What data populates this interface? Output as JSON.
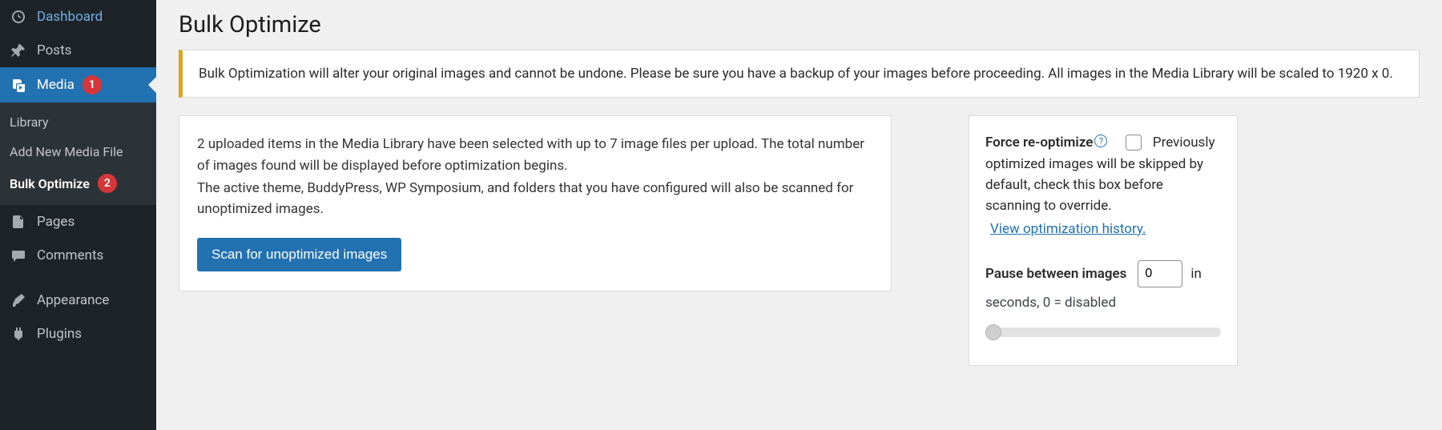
{
  "sidebar": {
    "items": [
      {
        "label": "Dashboard",
        "icon": "dashboard"
      },
      {
        "label": "Posts",
        "icon": "pin"
      },
      {
        "label": "Media",
        "icon": "media",
        "badge": "1",
        "active": true
      },
      {
        "label": "Pages",
        "icon": "pages"
      },
      {
        "label": "Comments",
        "icon": "comment"
      },
      {
        "label": "Appearance",
        "icon": "brush"
      },
      {
        "label": "Plugins",
        "icon": "plug"
      }
    ],
    "submenu": [
      {
        "label": "Library"
      },
      {
        "label": "Add New Media File"
      },
      {
        "label": "Bulk Optimize",
        "badge": "2",
        "current": true
      }
    ]
  },
  "page": {
    "title": "Bulk Optimize",
    "notice": "Bulk Optimization will alter your original images and cannot be undone. Please be sure you have a backup of your images before proceeding. All images in the Media Library will be scaled to 1920 x 0.",
    "info_line1": "2 uploaded items in the Media Library have been selected with up to 7 image files per upload. The total number of images found will be displayed before optimization begins.",
    "info_line2": "The active theme, BuddyPress, WP Symposium, and folders that you have configured will also be scanned for unoptimized images.",
    "scan_button": "Scan for unoptimized images"
  },
  "side": {
    "force_label": "Force re-optimize",
    "desc_start": "Previously",
    "desc_rest": "optimized images will be skipped by default, check this box before scanning to override.",
    "history_link": "View optimization history.",
    "pause_label": "Pause between images",
    "pause_value": "0",
    "pause_unit_start": "in",
    "pause_unit_rest": "seconds, 0 = disabled"
  }
}
